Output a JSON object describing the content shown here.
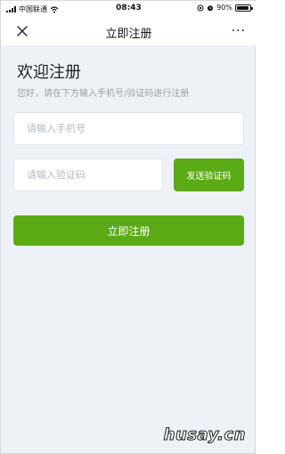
{
  "status_bar": {
    "carrier": "中国联通",
    "time": "08:43",
    "battery": "90%",
    "battery_level": 0.9
  },
  "nav": {
    "title": "立即注册",
    "close_icon": "close-icon",
    "more_icon": "more-icon",
    "more_glyph": "···"
  },
  "page": {
    "heading": "欢迎注册",
    "subtext": "您好，请在下方输入手机号/验证码进行注册"
  },
  "form": {
    "phone": {
      "value": "",
      "placeholder": "请输入手机号"
    },
    "code": {
      "value": "",
      "placeholder": "请输入验证码"
    },
    "send_code_label": "发送验证码",
    "register_label": "立即注册"
  },
  "watermark": "husay.cn",
  "colors": {
    "accent": "#5aab15",
    "background": "#eef2f6"
  }
}
